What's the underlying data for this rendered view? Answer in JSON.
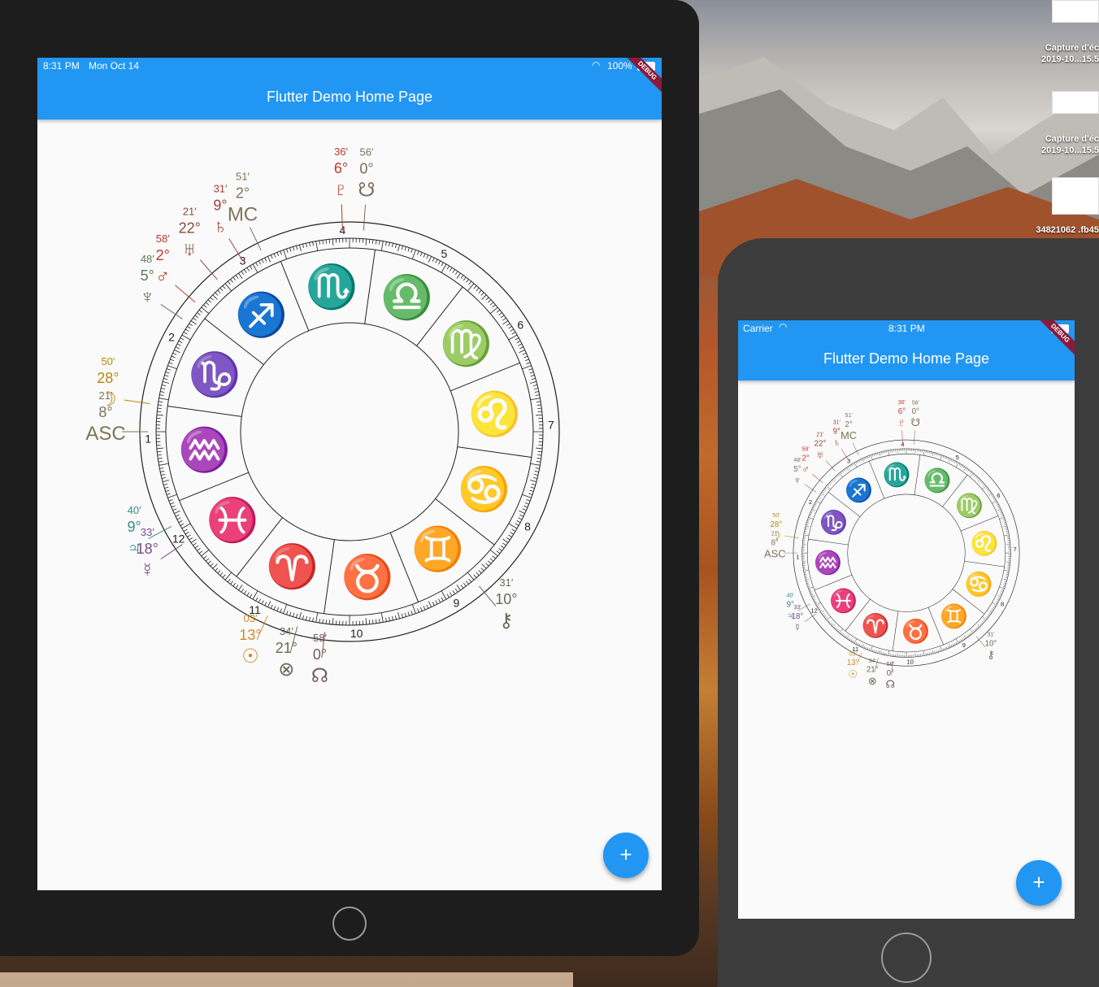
{
  "desktop": {
    "files": [
      {
        "label": "Capture d'éc 2019-10...15.5"
      },
      {
        "label": "Capture d'éc 2019-10...15.5"
      },
      {
        "label": "34821062 .fb45"
      }
    ]
  },
  "ipad": {
    "status": {
      "time": "8:31 PM",
      "date": "Mon Oct 14",
      "battery": "100%"
    },
    "title": "Flutter Demo Home Page",
    "debug": "DEBUG",
    "fab": "+"
  },
  "iphone": {
    "status": {
      "carrier": "Carrier",
      "time": "8:31 PM"
    },
    "title": "Flutter Demo Home Page",
    "debug": "DEBUG",
    "fab": "+"
  },
  "chart_data": {
    "type": "astrology-wheel",
    "houses": [
      "1",
      "2",
      "3",
      "4",
      "5",
      "6",
      "7",
      "8",
      "9",
      "10",
      "11",
      "12"
    ],
    "signs": [
      {
        "glyph": "♑",
        "color": "#f6a021"
      },
      {
        "glyph": "♐",
        "color": "#e53935"
      },
      {
        "glyph": "♏",
        "color": "#2196f3"
      },
      {
        "glyph": "♎",
        "color": "#43a047"
      },
      {
        "glyph": "♍",
        "color": "#f6a021"
      },
      {
        "glyph": "♌",
        "color": "#e53935"
      },
      {
        "glyph": "♋",
        "color": "#2196f3"
      },
      {
        "glyph": "♊",
        "color": "#43a047"
      },
      {
        "glyph": "♉",
        "color": "#f6a021"
      },
      {
        "glyph": "♈",
        "color": "#e53935"
      },
      {
        "glyph": "♓",
        "color": "#2196f3"
      },
      {
        "glyph": "♒",
        "color": "#43a047"
      }
    ],
    "planets": [
      {
        "glyph": "♇",
        "deg": "6°",
        "min": "36′",
        "color": "#c0392b"
      },
      {
        "glyph": "☋",
        "deg": "0°",
        "min": "56′",
        "color": "#7d6b5a"
      },
      {
        "glyph": "MC",
        "deg": "2°",
        "min": "51′",
        "color": "#7d7558"
      },
      {
        "glyph": "♄",
        "deg": "9°",
        "min": "31′",
        "color": "#a0413a"
      },
      {
        "glyph": "♅",
        "deg": "22°",
        "min": "21′",
        "color": "#8a4a3a"
      },
      {
        "glyph": "♂",
        "deg": "2°",
        "min": "58′",
        "color": "#c0392b"
      },
      {
        "glyph": "♆",
        "deg": "5°",
        "min": "48′",
        "color": "#5f7a5a"
      },
      {
        "glyph": "☽",
        "deg": "28°",
        "min": "50′",
        "color": "#b8860b"
      },
      {
        "glyph": "ASC",
        "deg": "8°",
        "min": "21′",
        "color": "#7d7558"
      },
      {
        "glyph": "♃",
        "deg": "9°",
        "min": "40′",
        "color": "#3a8a8a"
      },
      {
        "glyph": "☿",
        "deg": "18°",
        "min": "33′",
        "color": "#7a4a8a"
      },
      {
        "glyph": "☉",
        "deg": "13°",
        "min": "03′",
        "color": "#d08a2a"
      },
      {
        "glyph": "⊗",
        "deg": "21°",
        "min": "34′",
        "color": "#6a6a5a"
      },
      {
        "glyph": "☊",
        "deg": "0°",
        "min": "58′",
        "color": "#7a5a5a"
      },
      {
        "glyph": "⚷",
        "deg": "10°",
        "min": "31′",
        "color": "#6a6a5a"
      }
    ]
  }
}
